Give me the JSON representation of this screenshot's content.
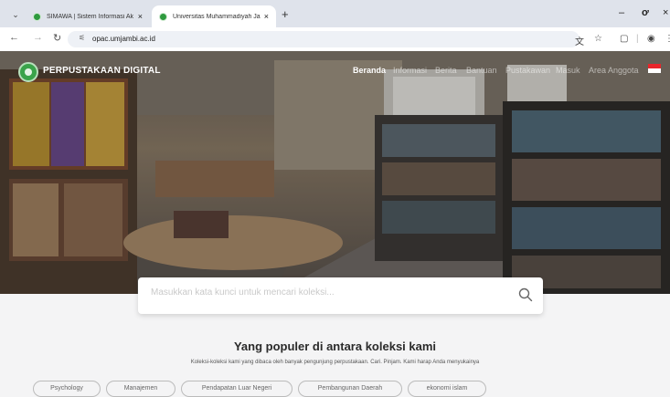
{
  "browser": {
    "tabs": [
      {
        "title": "SIMAWA | Sistem Informasi Ak",
        "active": false
      },
      {
        "title": "Universitas Muhammadiyah Ja",
        "active": true
      }
    ],
    "close_glyph": "×",
    "new_tab_glyph": "+",
    "url": "opac.umjambi.ac.id",
    "window_controls": {
      "minimize": "–",
      "maximize": "ơ",
      "close": "×"
    },
    "icons": [
      "tab-list-icon",
      "back-icon",
      "forward-icon",
      "reload-icon",
      "site-settings-icon",
      "translate-icon",
      "bookmark-star-icon",
      "extensions-icon",
      "profile-icon",
      "menu-icon"
    ]
  },
  "site": {
    "brand": "PERPUSTAKAAN DIGITAL",
    "brand_color": "#3aa34a",
    "nav": [
      "Beranda",
      "Informasi",
      "Berita",
      "Bantuan",
      "Pustakawan",
      "Masuk",
      "Area Anggota"
    ],
    "active_nav": "Beranda"
  },
  "search": {
    "placeholder": "Masukkan kata kunci untuk mencari koleksi..."
  },
  "popular": {
    "title": "Yang populer di antara koleksi kami",
    "subtitle": "Koleksi-koleksi kami yang dibaca oleh banyak pengunjung perpustakaan. Cari. Pinjam. Kami harap Anda menyukainya",
    "chips": [
      "Psychology",
      "Manajemen",
      "Pendapatan Luar Negeri",
      "Pembangunan Daerah",
      "ekonomi islam"
    ]
  }
}
